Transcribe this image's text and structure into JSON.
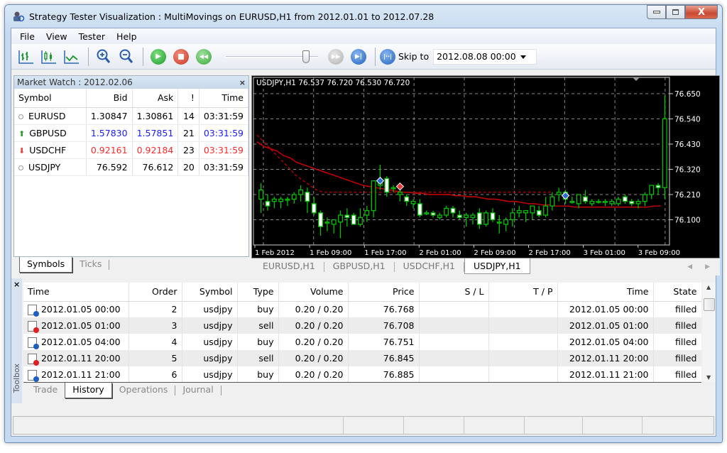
{
  "window": {
    "title": "Strategy Tester Visualization : MultiMovings on EURUSD,H1 from 2012.01.01 to 2012.07.28",
    "minimize_label": "–",
    "maximize_label": "▫",
    "close_label": "X"
  },
  "menu": [
    "File",
    "View",
    "Tester",
    "Help"
  ],
  "toolbar": {
    "buttons": [
      "bar-chart-icon",
      "candlestick-chart-icon",
      "line-chart-icon",
      "zoom-in-icon",
      "zoom-out-icon",
      "play-icon",
      "stop-icon",
      "rewind-icon"
    ],
    "speed_slider": 0.9,
    "skip_label": "Skip to",
    "skip_value": "2012.08.08 00:00"
  },
  "market_watch": {
    "title": "Market Watch : 2012.02.06",
    "close": "×",
    "columns": [
      "Symbol",
      "Bid",
      "Ask",
      "!",
      "Time"
    ],
    "rows": [
      {
        "symbol": "EURUSD",
        "bid": "1.30847",
        "ask": "1.30861",
        "spread": "14",
        "time": "03:31:59",
        "trend": "none"
      },
      {
        "symbol": "GBPUSD",
        "bid": "1.57830",
        "ask": "1.57851",
        "spread": "21",
        "time": "03:31:59",
        "trend": "up"
      },
      {
        "symbol": "USDCHF",
        "bid": "0.92161",
        "ask": "0.92184",
        "spread": "23",
        "time": "03:31:59",
        "trend": "down"
      },
      {
        "symbol": "USDJPY",
        "bid": "76.592",
        "ask": "76.612",
        "spread": "20",
        "time": "03:31:59",
        "trend": "none"
      }
    ],
    "tabs": [
      "Symbols",
      "Ticks"
    ],
    "active_tab": 0
  },
  "chart": {
    "tabs": [
      "EURUSD,H1",
      "GBPUSD,H1",
      "USDCHF,H1",
      "USDJPY,H1"
    ],
    "active_tab": 3
  },
  "chart_data": {
    "type": "candlestick",
    "title": "USDJPY,H1  76.537 76.720 76.530 76.720",
    "y_ticks": [
      "76.650",
      "76.540",
      "76.430",
      "76.320",
      "76.210",
      "76.100"
    ],
    "ylim": [
      75.99,
      76.69
    ],
    "x_ticks": [
      "1 Feb 2012",
      "1 Feb 09:00",
      "1 Feb 17:00",
      "2 Feb 01:00",
      "2 Feb 09:00",
      "2 Feb 17:00",
      "3 Feb 01:00",
      "3 Feb 09:00"
    ],
    "grid": true,
    "colors": {
      "bull": "#ffffff",
      "outline": "#00c000",
      "ma": "#c00000",
      "grid": "#8a8a8a",
      "axis_text": "#ffffff"
    },
    "candles": [
      [
        76.19,
        76.26,
        76.13,
        76.23
      ],
      [
        76.18,
        76.21,
        76.14,
        76.16
      ],
      [
        76.18,
        76.2,
        76.15,
        76.19
      ],
      [
        76.18,
        76.2,
        76.15,
        76.19
      ],
      [
        76.19,
        76.2,
        76.16,
        76.19
      ],
      [
        76.19,
        76.22,
        76.17,
        76.21
      ],
      [
        76.21,
        76.25,
        76.18,
        76.23
      ],
      [
        76.22,
        76.24,
        76.13,
        76.18
      ],
      [
        76.17,
        76.2,
        76.12,
        76.13
      ],
      [
        76.13,
        76.14,
        76.03,
        76.07
      ],
      [
        76.09,
        76.11,
        76.05,
        76.09
      ],
      [
        76.08,
        76.1,
        76.04,
        76.1
      ],
      [
        76.09,
        76.14,
        76.02,
        76.12
      ],
      [
        76.12,
        76.15,
        76.07,
        76.11
      ],
      [
        76.12,
        76.13,
        76.08,
        76.08
      ],
      [
        76.08,
        76.15,
        76.07,
        76.11
      ],
      [
        76.12,
        76.16,
        76.09,
        76.14
      ],
      [
        76.14,
        76.27,
        76.11,
        76.27
      ],
      [
        76.25,
        76.34,
        76.23,
        76.27
      ],
      [
        76.28,
        76.29,
        76.2,
        76.22
      ],
      [
        76.24,
        76.25,
        76.22,
        76.24
      ],
      [
        76.21,
        76.23,
        76.18,
        76.22
      ],
      [
        76.2,
        76.21,
        76.16,
        76.18
      ],
      [
        76.17,
        76.19,
        76.15,
        76.18
      ],
      [
        76.17,
        76.19,
        76.11,
        76.12
      ],
      [
        76.13,
        76.14,
        76.12,
        76.13
      ],
      [
        76.13,
        76.14,
        76.11,
        76.12
      ],
      [
        76.11,
        76.13,
        76.1,
        76.12
      ],
      [
        76.12,
        76.16,
        76.11,
        76.15
      ],
      [
        76.15,
        76.16,
        76.11,
        76.13
      ],
      [
        76.12,
        76.14,
        76.1,
        76.11
      ],
      [
        76.11,
        76.13,
        76.07,
        76.12
      ],
      [
        76.11,
        76.13,
        76.08,
        76.12
      ],
      [
        76.13,
        76.15,
        76.06,
        76.08
      ],
      [
        76.08,
        76.14,
        76.07,
        76.13
      ],
      [
        76.13,
        76.15,
        76.09,
        76.1
      ],
      [
        76.09,
        76.12,
        76.04,
        76.09
      ],
      [
        76.08,
        76.11,
        76.05,
        76.1
      ],
      [
        76.1,
        76.15,
        76.07,
        76.13
      ],
      [
        76.13,
        76.16,
        76.11,
        76.14
      ],
      [
        76.13,
        76.14,
        76.09,
        76.14
      ],
      [
        76.13,
        76.16,
        76.1,
        76.16
      ],
      [
        76.14,
        76.16,
        76.11,
        76.12
      ],
      [
        76.12,
        76.2,
        76.11,
        76.16
      ],
      [
        76.16,
        76.22,
        76.14,
        76.2
      ],
      [
        76.21,
        76.24,
        76.18,
        76.22
      ],
      [
        76.22,
        76.23,
        76.17,
        76.19
      ],
      [
        76.18,
        76.2,
        76.17,
        76.18
      ],
      [
        76.17,
        76.21,
        76.15,
        76.21
      ],
      [
        76.2,
        76.23,
        76.17,
        76.18
      ],
      [
        76.17,
        76.19,
        76.16,
        76.18
      ],
      [
        76.18,
        76.19,
        76.17,
        76.18
      ],
      [
        76.18,
        76.19,
        76.16,
        76.18
      ],
      [
        76.17,
        76.19,
        76.16,
        76.18
      ],
      [
        76.17,
        76.2,
        76.16,
        76.19
      ],
      [
        76.2,
        76.21,
        76.17,
        76.18
      ],
      [
        76.18,
        76.19,
        76.16,
        76.17
      ],
      [
        76.17,
        76.19,
        76.15,
        76.18
      ],
      [
        76.18,
        76.22,
        76.16,
        76.21
      ],
      [
        76.21,
        76.25,
        76.19,
        76.25
      ],
      [
        76.25,
        76.26,
        76.21,
        76.24
      ],
      [
        76.24,
        76.64,
        76.19,
        76.54
      ]
    ],
    "ma_solid": [
      76.44,
      76.42,
      76.41,
      76.4,
      76.38,
      76.37,
      76.35,
      76.34,
      76.33,
      76.32,
      76.31,
      76.3,
      76.29,
      76.28,
      76.27,
      76.26,
      76.25,
      76.245,
      76.24,
      76.235,
      76.23,
      76.225,
      76.22,
      76.22,
      76.215,
      76.215,
      76.21,
      76.21,
      76.21,
      76.21,
      76.205,
      76.205,
      76.2,
      76.2,
      76.195,
      76.19,
      76.19,
      76.185,
      76.18,
      76.18,
      76.175,
      76.17,
      76.17,
      76.165,
      76.165,
      76.16,
      76.16,
      76.16,
      76.155,
      76.155,
      76.155,
      76.155,
      76.155,
      76.155,
      76.155,
      76.155,
      76.155,
      76.155,
      76.155,
      76.155,
      76.16,
      76.16
    ],
    "ma_dashed_start": [
      76.47,
      76.44,
      76.41,
      76.38,
      76.35,
      76.32,
      76.29,
      76.27,
      76.25,
      76.23,
      76.22,
      76.22,
      76.22,
      76.22,
      76.22,
      76.22,
      76.22,
      76.22,
      76.22,
      76.22
    ],
    "signals": [
      {
        "index": 18,
        "price": 76.27,
        "type": "buy"
      },
      {
        "index": 21,
        "price": 76.245,
        "type": "sell"
      },
      {
        "index": 46,
        "price": 76.205,
        "type": "buy"
      }
    ]
  },
  "toolbox": {
    "close": "×",
    "label": "Toolbox",
    "columns": [
      "Time",
      "Order",
      "Symbol",
      "Type",
      "Volume",
      "Price",
      "S / L",
      "T / P",
      "Time",
      "State"
    ],
    "rows": [
      {
        "time": "2012.01.05 00:00",
        "order": "2",
        "symbol": "usdjpy",
        "type": "buy",
        "volume": "0.20 / 0.20",
        "price": "76.768",
        "sl": "",
        "tp": "",
        "time2": "2012.01.05 00:00",
        "state": "filled"
      },
      {
        "time": "2012.01.05 01:00",
        "order": "3",
        "symbol": "usdjpy",
        "type": "sell",
        "volume": "0.20 / 0.20",
        "price": "76.708",
        "sl": "",
        "tp": "",
        "time2": "2012.01.05 01:00",
        "state": "filled"
      },
      {
        "time": "2012.01.05 04:00",
        "order": "4",
        "symbol": "usdjpy",
        "type": "buy",
        "volume": "0.20 / 0.20",
        "price": "76.751",
        "sl": "",
        "tp": "",
        "time2": "2012.01.05 04:00",
        "state": "filled"
      },
      {
        "time": "2012.01.11 20:00",
        "order": "5",
        "symbol": "usdjpy",
        "type": "sell",
        "volume": "0.20 / 0.20",
        "price": "76.845",
        "sl": "",
        "tp": "",
        "time2": "2012.01.11 20:00",
        "state": "filled"
      },
      {
        "time": "2012.01.11 21:00",
        "order": "6",
        "symbol": "usdjpy",
        "type": "buy",
        "volume": "0.20 / 0.20",
        "price": "76.885",
        "sl": "",
        "tp": "",
        "time2": "2012.01.11 21:00",
        "state": "filled"
      }
    ],
    "tabs": [
      "Trade",
      "History",
      "Operations",
      "Journal"
    ],
    "active_tab": 1
  }
}
